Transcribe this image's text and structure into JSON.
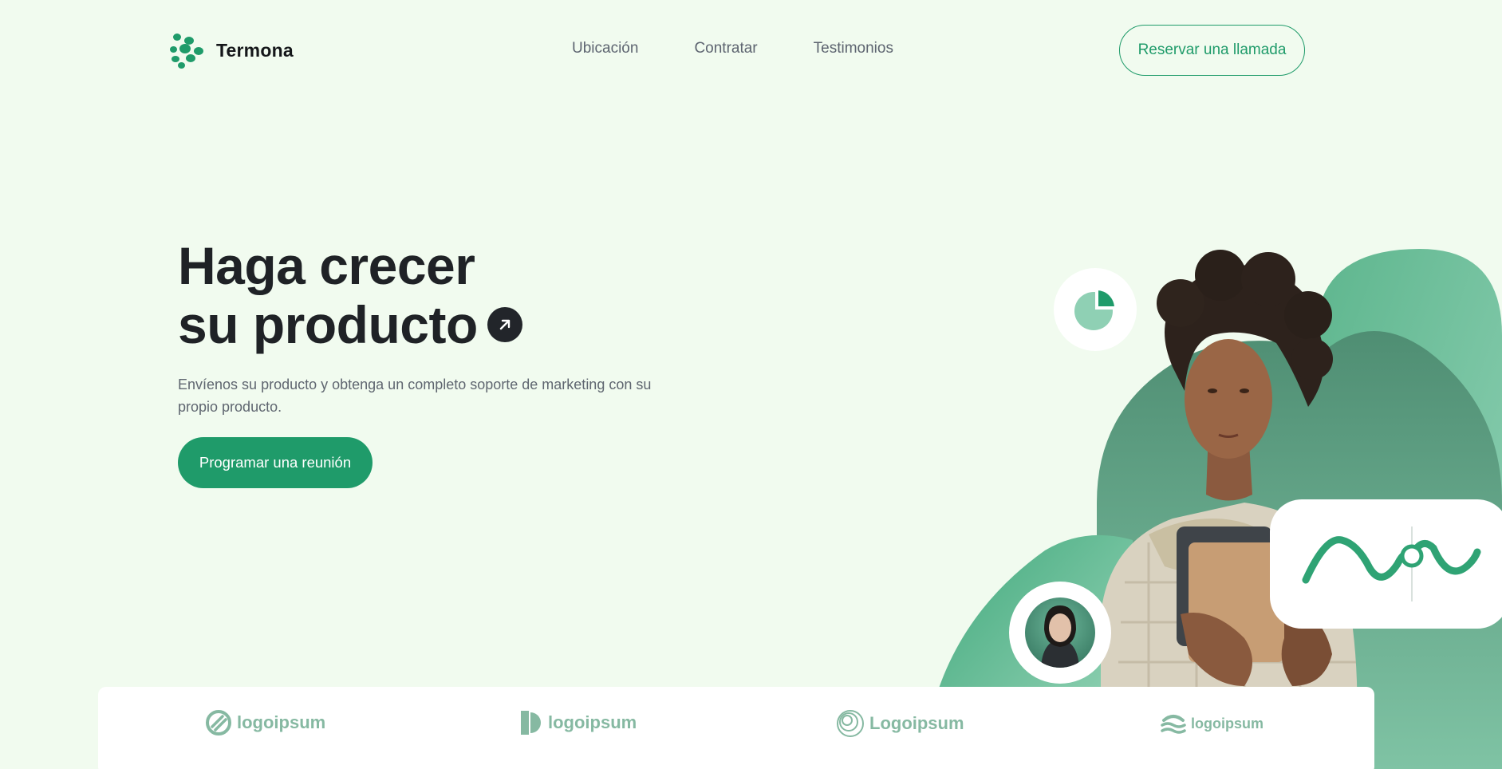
{
  "brand": {
    "name": "Termona"
  },
  "nav": {
    "links": [
      "Ubicación",
      "Contratar",
      "Testimonios"
    ],
    "cta_label": "Reservar una llamada"
  },
  "hero": {
    "title_line1": "Haga crecer",
    "title_line2": "su producto",
    "subtitle": "Envíenos su producto y obtenga un completo soporte de marketing con su propio producto.",
    "cta_label": "Programar una reunión"
  },
  "logos": [
    {
      "text": "logoipsum",
      "icon": "circle-slash-logo-icon"
    },
    {
      "text": "logoipsum",
      "icon": "half-circle-logo-icon"
    },
    {
      "text": "Logoipsum",
      "icon": "concentric-circle-logo-icon"
    },
    {
      "text": "logoipsum",
      "icon": "waves-logo-icon"
    }
  ],
  "colors": {
    "background": "#f1fbef",
    "accent": "#1f9b6a",
    "accent_light": "#8fd0b4",
    "text_dark": "#1f2226",
    "text_muted": "#5f6670",
    "logo_gray_green": "#86b9a2"
  }
}
